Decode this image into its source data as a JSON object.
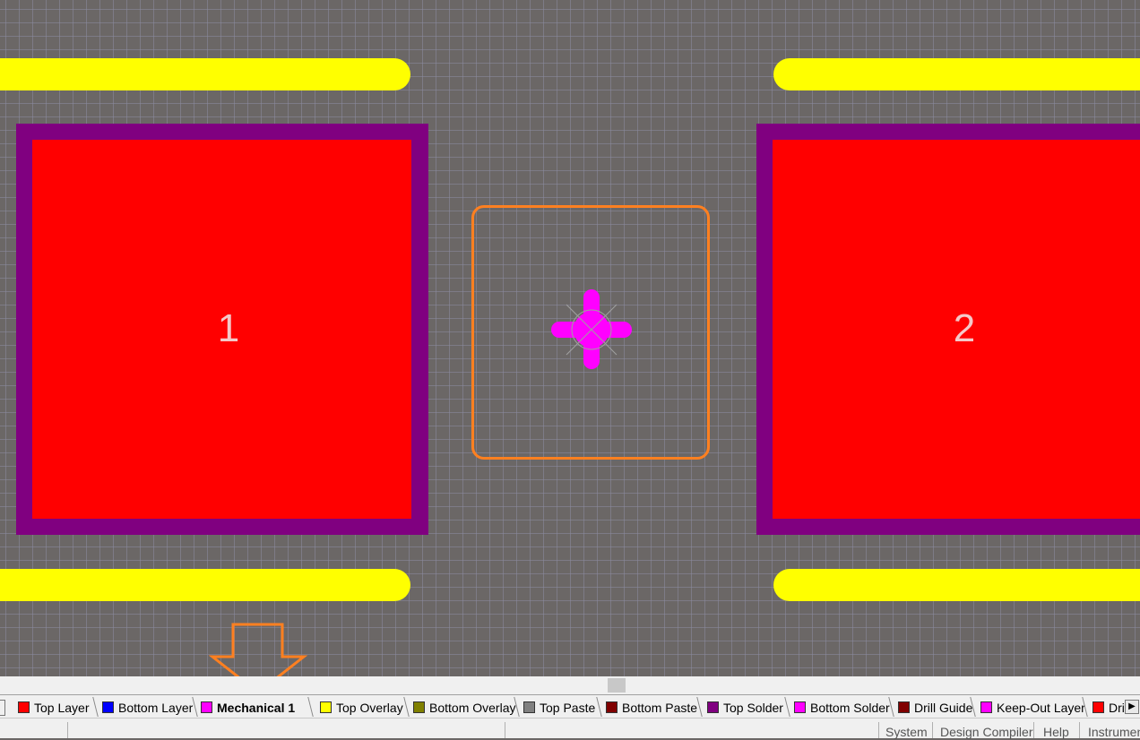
{
  "pcb": {
    "pads": [
      {
        "designator": "1"
      },
      {
        "designator": "2"
      }
    ],
    "colors": {
      "background": "#6b6766",
      "grid": "#8c8ca0",
      "top_overlay": "#ffff00",
      "top_solder": "#800080",
      "top_layer": "#ff0000",
      "courtyard": "#ff8020",
      "origin_marker": "#ff00ff"
    }
  },
  "layer_tabs": [
    {
      "label": "Top Layer",
      "color": "#ff0000"
    },
    {
      "label": "Bottom Layer",
      "color": "#0000ff"
    },
    {
      "label": "Mechanical 1",
      "color": "#ff00ff",
      "active": true
    },
    {
      "label": "Top Overlay",
      "color": "#ffff00"
    },
    {
      "label": "Bottom Overlay",
      "color": "#808000"
    },
    {
      "label": "Top Paste",
      "color": "#808080"
    },
    {
      "label": "Bottom Paste",
      "color": "#800000"
    },
    {
      "label": "Top Solder",
      "color": "#800080"
    },
    {
      "label": "Bottom Solder",
      "color": "#ff00ff"
    },
    {
      "label": "Drill Guide",
      "color": "#800000"
    },
    {
      "label": "Keep-Out Layer",
      "color": "#ff00ff"
    },
    {
      "label": "Dril",
      "color": "#ff0000"
    }
  ],
  "status_bar": {
    "buttons": [
      "System",
      "Design Compiler",
      "Help",
      "Instrumen"
    ]
  }
}
